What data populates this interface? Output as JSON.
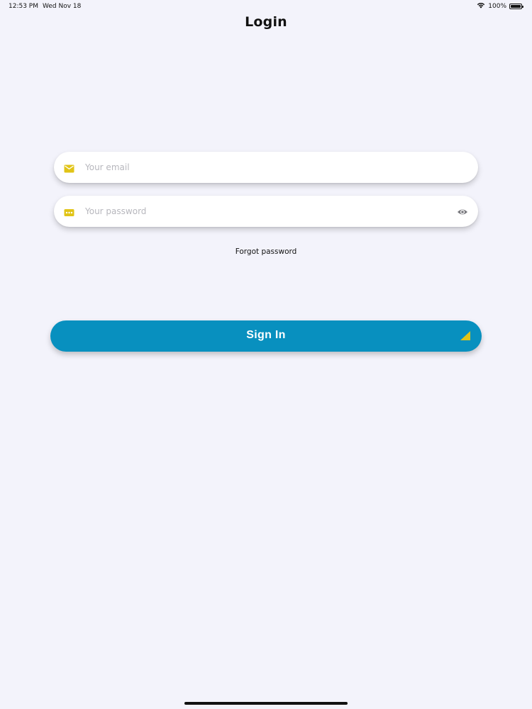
{
  "status_bar": {
    "time": "12:53 PM",
    "date": "Wed Nov 18",
    "battery": "100%"
  },
  "page": {
    "title": "Login"
  },
  "email": {
    "placeholder": "Your email",
    "icon": "mail-icon"
  },
  "password": {
    "placeholder": "Your password",
    "icon": "password-dots-icon",
    "toggle_icon": "eye-icon"
  },
  "forgot": {
    "label": "Forgot password"
  },
  "sign_in": {
    "label": "Sign In"
  },
  "colors": {
    "background": "#f3f3fb",
    "accent": "#0890bf",
    "icon_yellow": "#e1c417"
  }
}
